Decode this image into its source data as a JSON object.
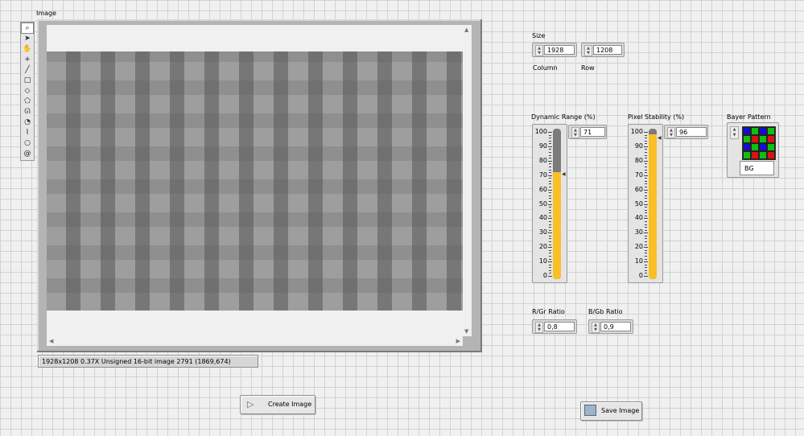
{
  "image_panel": {
    "label": "Image",
    "status": "1928x1208 0.37X Unsigned 16-bit image 2791    (1869,674)",
    "tools": [
      "zoom-icon",
      "pointer-icon",
      "pan-icon",
      "crosshair-icon",
      "line-icon",
      "rectangle-icon",
      "rotated-rectangle-icon",
      "polygon-icon",
      "freehand-icon",
      "annulus-icon",
      "broken-line-icon",
      "oval-icon",
      "spiral-icon"
    ]
  },
  "size": {
    "label": "Size",
    "column": {
      "label": "Column",
      "value": "1928"
    },
    "row": {
      "label": "Row",
      "value": "1208"
    }
  },
  "dynamic_range": {
    "label": "Dynamic Range (%)",
    "value": "71",
    "scale": [
      "100",
      "90",
      "80",
      "70",
      "60",
      "50",
      "40",
      "30",
      "20",
      "10",
      "0"
    ],
    "level": 71
  },
  "pixel_stability": {
    "label": "Pixel Stability (%)",
    "value": "96",
    "scale": [
      "100",
      "90",
      "80",
      "70",
      "60",
      "50",
      "40",
      "30",
      "20",
      "10",
      "0"
    ],
    "level": 96
  },
  "bayer": {
    "label": "Bayer Pattern",
    "value": "BG",
    "colors": {
      "blue": "#1010c8",
      "green": "#10c010",
      "red": "#e01010"
    }
  },
  "ratios": {
    "rgr": {
      "label": "R/Gr Ratio",
      "value": "0,8"
    },
    "bgb": {
      "label": "B/Gb Ratio",
      "value": "0,9"
    }
  },
  "buttons": {
    "create": "Create Image",
    "save": "Save Image"
  },
  "colors": {
    "slider_fill": "#fbbf26",
    "slider_track": "#7b7b7b"
  }
}
